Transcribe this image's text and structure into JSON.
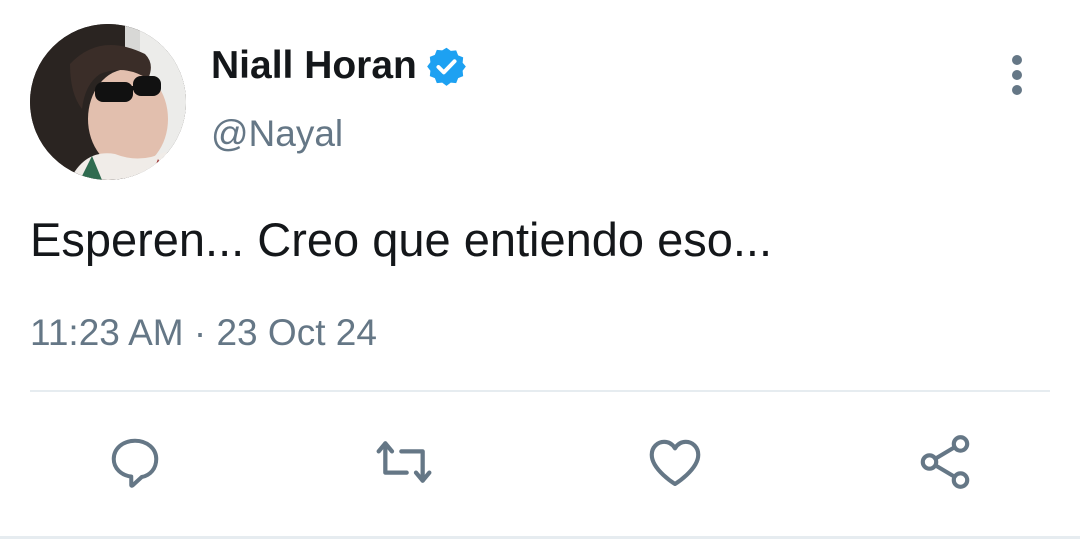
{
  "tweet": {
    "display_name": "Niall Horan",
    "handle": "@Nayal",
    "verified": true,
    "text": "Esperen... Creo que entiendo eso...",
    "time": "11:23 AM",
    "separator": "·",
    "date": "23 Oct 24"
  },
  "icons": {
    "avatar": "profile-photo",
    "verified": "verified-badge-icon",
    "more": "more-vertical-icon",
    "reply": "reply-icon",
    "retweet": "retweet-icon",
    "like": "heart-icon",
    "share": "share-icon"
  },
  "colors": {
    "text_primary": "#14171a",
    "text_secondary": "#657786",
    "verified_blue": "#1da1f2",
    "divider": "#e6ecf0"
  }
}
